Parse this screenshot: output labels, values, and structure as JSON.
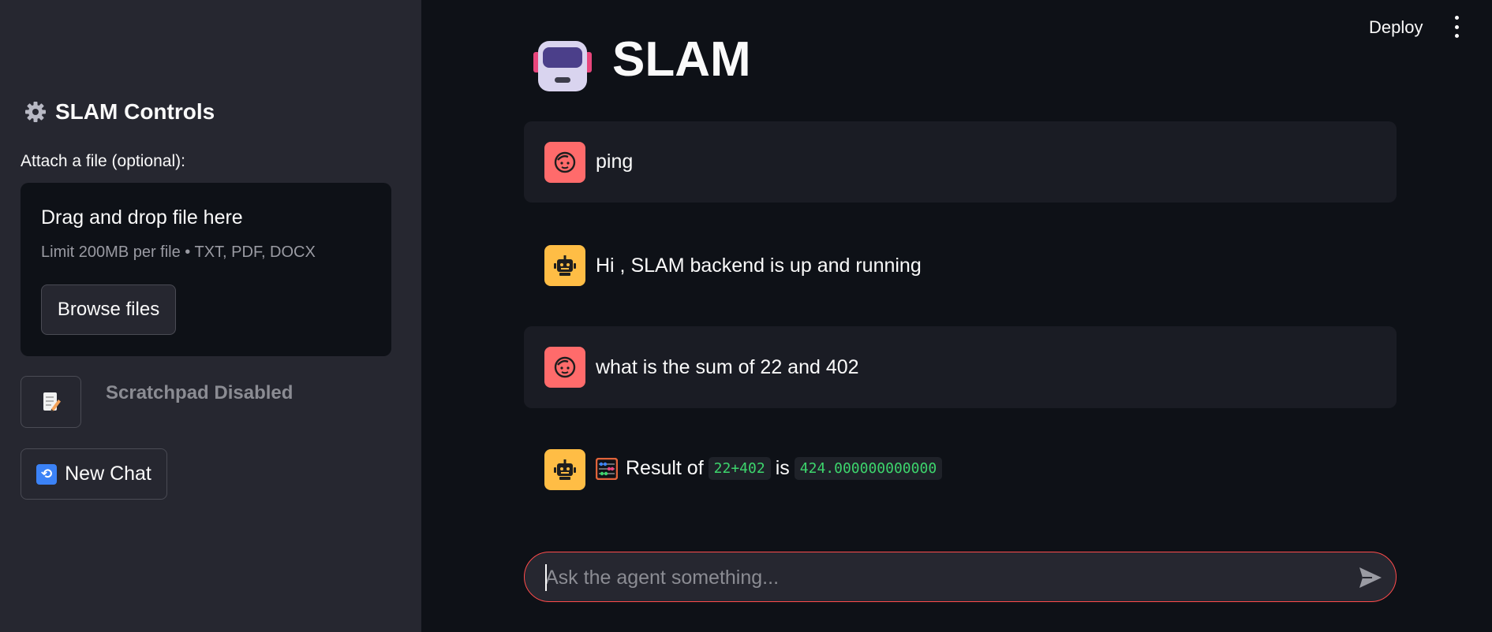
{
  "sidebar": {
    "title": "SLAM Controls",
    "attach_label": "Attach a file (optional):",
    "dropzone": {
      "title": "Drag and drop file here",
      "limit": "Limit 200MB per file • TXT, PDF, DOCX",
      "browse_label": "Browse files"
    },
    "scratchpad_label": "Scratchpad Disabled",
    "new_chat_label": "New Chat"
  },
  "topbar": {
    "deploy_label": "Deploy"
  },
  "main": {
    "title": "SLAM"
  },
  "messages": [
    {
      "role": "user",
      "text": "ping"
    },
    {
      "role": "assistant",
      "text": "Hi , SLAM backend is up and running"
    },
    {
      "role": "user",
      "text": "what is the sum of 22 and 402"
    },
    {
      "role": "assistant",
      "prefix": "Result of",
      "expr": "22+402",
      "middle": "is",
      "result": "424.000000000000"
    }
  ],
  "chat_input": {
    "placeholder": "Ask the agent something..."
  },
  "icons": {
    "sidebar_header": "gear-icon",
    "scratchpad": "memo-icon",
    "new_chat": "refresh-icon",
    "user_avatar": "face-icon",
    "bot_avatar": "robot-icon",
    "result_prefix": "abacus-icon",
    "send": "send-icon",
    "menu": "kebab-menu-icon"
  },
  "colors": {
    "accent": "#ff4b4b",
    "user_avatar": "#ff6b6b",
    "bot_avatar": "#ffbd45",
    "code_text": "#3dd56d"
  }
}
